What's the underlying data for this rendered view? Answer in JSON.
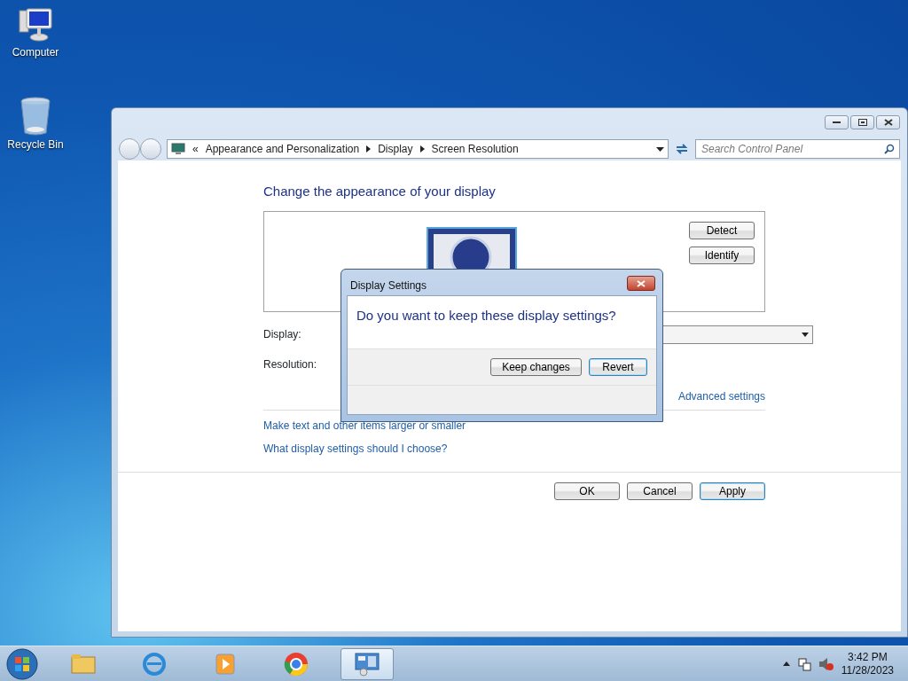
{
  "desktop_icons": [
    {
      "kind": "computer",
      "label": "Computer"
    },
    {
      "kind": "recycle",
      "label": "Recycle Bin"
    }
  ],
  "window": {
    "breadcrumb": [
      "Appearance and Personalization",
      "Display",
      "Screen Resolution"
    ],
    "breadcrumb_prefix": "«",
    "search": {
      "placeholder": "Search Control Panel"
    },
    "heading": "Change the appearance of your display",
    "side_buttons": [
      "Detect",
      "Identify"
    ],
    "fields": [
      {
        "label": "Display:"
      },
      {
        "label": "Resolution:"
      }
    ],
    "advanced_link": "Advanced settings",
    "links": [
      "Make text and other items larger or smaller",
      "What display settings should I choose?"
    ],
    "buttons": [
      {
        "label": "OK",
        "default": false
      },
      {
        "label": "Cancel",
        "default": false
      },
      {
        "label": "Apply",
        "default": true
      }
    ]
  },
  "dialog": {
    "title": "Display Settings",
    "message": "Do you want to keep these display settings?",
    "buttons": [
      {
        "label": "Keep changes",
        "default": false
      },
      {
        "label": "Revert",
        "default": true
      }
    ]
  },
  "taskbar": {
    "apps": [
      {
        "kind": "folder",
        "active": false
      },
      {
        "kind": "ie",
        "active": false
      },
      {
        "kind": "media",
        "active": false
      },
      {
        "kind": "chrome",
        "active": false
      },
      {
        "kind": "control",
        "active": true
      }
    ],
    "clock": {
      "time": "3:42 PM",
      "date": "11/28/2023"
    }
  }
}
